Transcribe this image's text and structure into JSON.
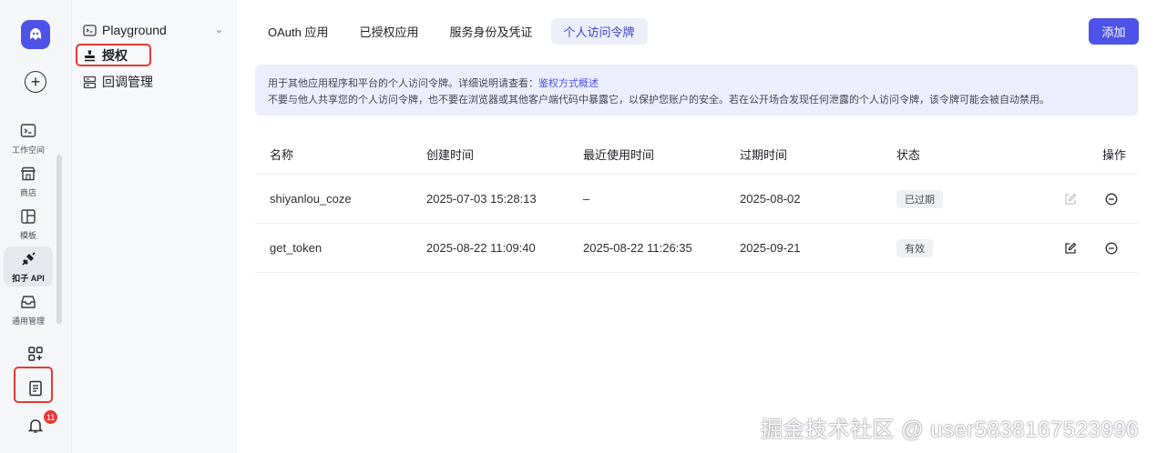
{
  "rail": {
    "items": [
      {
        "label": "工作空间",
        "icon": "terminal-icon"
      },
      {
        "label": "商店",
        "icon": "store-icon"
      },
      {
        "label": "模板",
        "icon": "template-icon"
      },
      {
        "label": "扣子 API",
        "icon": "api-plug-icon",
        "active": true
      },
      {
        "label": "通用管理",
        "icon": "inbox-icon"
      }
    ],
    "notification_count": "11"
  },
  "subnav": {
    "header": "Playground",
    "items": [
      {
        "label": "授权",
        "active": true
      },
      {
        "label": "回调管理"
      }
    ]
  },
  "tabs": [
    {
      "label": "OAuth 应用"
    },
    {
      "label": "已授权应用"
    },
    {
      "label": "服务身份及凭证"
    },
    {
      "label": "个人访问令牌",
      "active": true
    }
  ],
  "add_button": "添加",
  "notice": {
    "line1": "用于其他应用程序和平台的个人访问令牌。详细说明请查看：",
    "link": "鉴权方式概述",
    "line2": "不要与他人共享您的个人访问令牌，也不要在浏览器或其他客户端代码中暴露它，以保护您账户的安全。若在公开场合发现任何泄露的个人访问令牌，该令牌可能会被自动禁用。"
  },
  "table": {
    "headers": {
      "name": "名称",
      "created": "创建时间",
      "used": "最近使用时间",
      "expires": "过期时间",
      "status": "状态",
      "ops": "操作"
    },
    "rows": [
      {
        "name": "shiyanlou_coze",
        "created": "2025-07-03 15:28:13",
        "used": "–",
        "expires": "2025-08-02",
        "status": "已过期",
        "editable": false
      },
      {
        "name": "get_token",
        "created": "2025-08-22 11:09:40",
        "used": "2025-08-22 11:26:35",
        "expires": "2025-09-21",
        "status": "有效",
        "editable": true
      }
    ]
  },
  "watermark": "掘金技术社区 @ user5838167523996",
  "colors": {
    "accent": "#4d53e8",
    "highlight_box": "#e53935",
    "badge_bg": "#e53935"
  }
}
